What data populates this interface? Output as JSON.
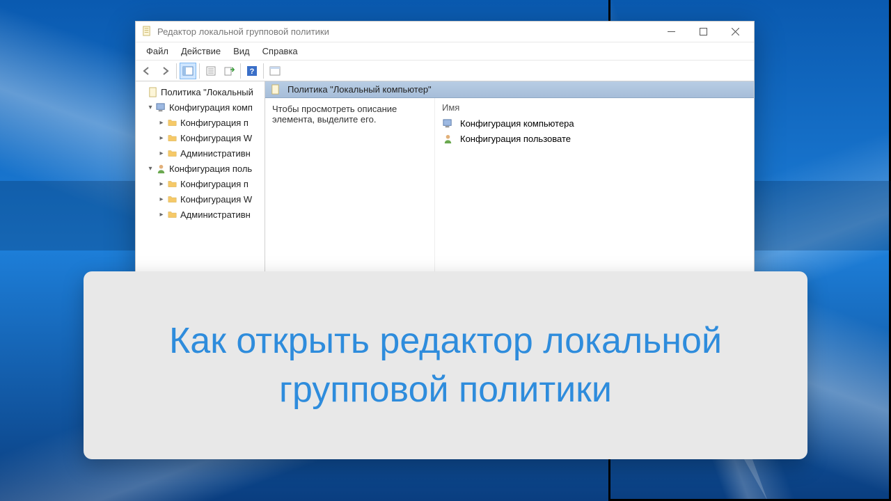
{
  "window": {
    "title": "Редактор локальной групповой политики"
  },
  "menu": {
    "file": "Файл",
    "action": "Действие",
    "view": "Вид",
    "help": "Справка"
  },
  "tree": {
    "root": "Политика \"Локальный",
    "comp": "Конфигурация комп",
    "comp_soft": "Конфигурация п",
    "comp_win": "Конфигурация W",
    "comp_admin": "Административн",
    "user": "Конфигурация поль",
    "user_soft": "Конфигурация п",
    "user_win": "Конфигурация W",
    "user_admin": "Административн"
  },
  "main": {
    "header": "Политика \"Локальный компьютер\"",
    "desc": "Чтобы просмотреть описание элемента, выделите его.",
    "col_name": "Имя",
    "item_comp": "Конфигурация компьютера",
    "item_user": "Конфигурация пользовате"
  },
  "caption": "Как открыть редактор локальной групповой политики"
}
